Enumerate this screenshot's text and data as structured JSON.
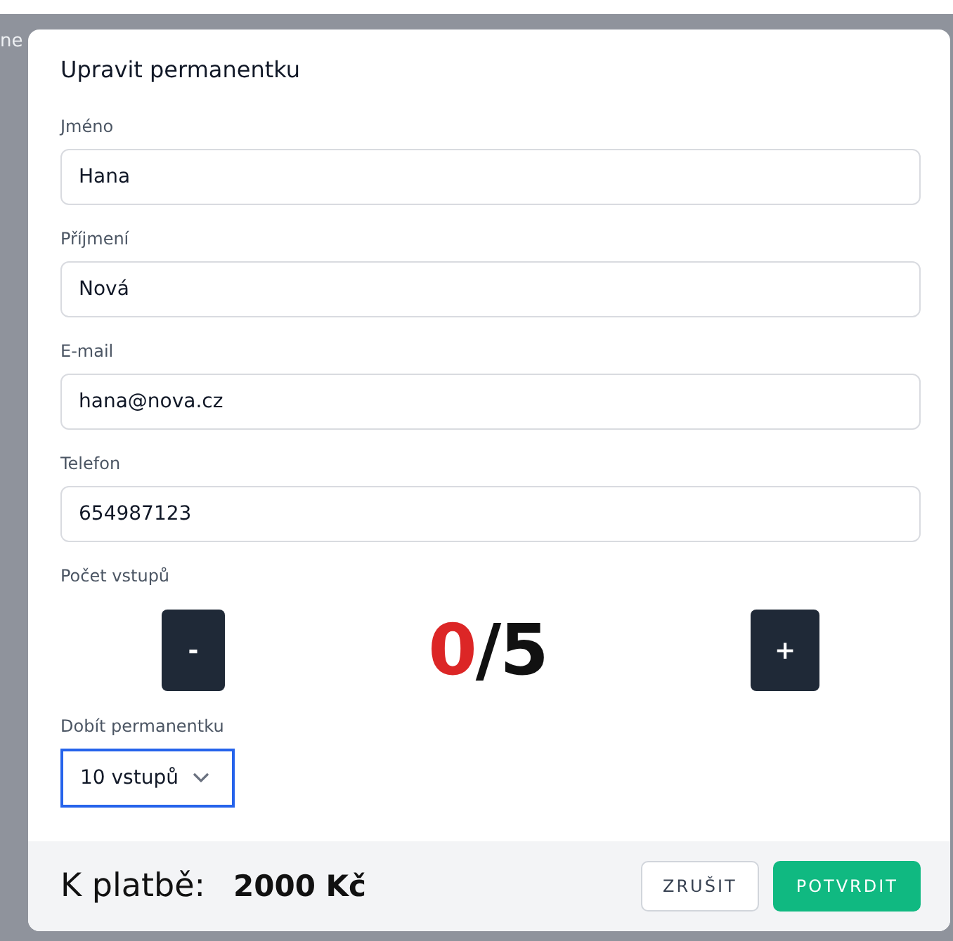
{
  "background": {
    "fragment": "ne"
  },
  "dialog": {
    "title": "Upravit permanentku",
    "fields": [
      {
        "label": "Jméno",
        "value": "Hana"
      },
      {
        "label": "Příjmení",
        "value": "Nová"
      },
      {
        "label": "E-mail",
        "value": "hana@nova.cz"
      },
      {
        "label": "Telefon",
        "value": "654987123"
      }
    ],
    "entries": {
      "label": "Počet vstupů",
      "decrement": "-",
      "increment": "+",
      "used": "0",
      "separator": "/",
      "total": "5",
      "exhausted": true
    },
    "recharge": {
      "label": "Dobít permanentku",
      "value": "10 vstupů",
      "focused": true
    },
    "footer": {
      "total_label": "K platbě:",
      "total_value": "2000 Kč",
      "buttons": [
        {
          "label": "ZRUŠIT",
          "kind": "secondary"
        },
        {
          "label": "POTVRDIT",
          "kind": "primary"
        }
      ]
    }
  }
}
